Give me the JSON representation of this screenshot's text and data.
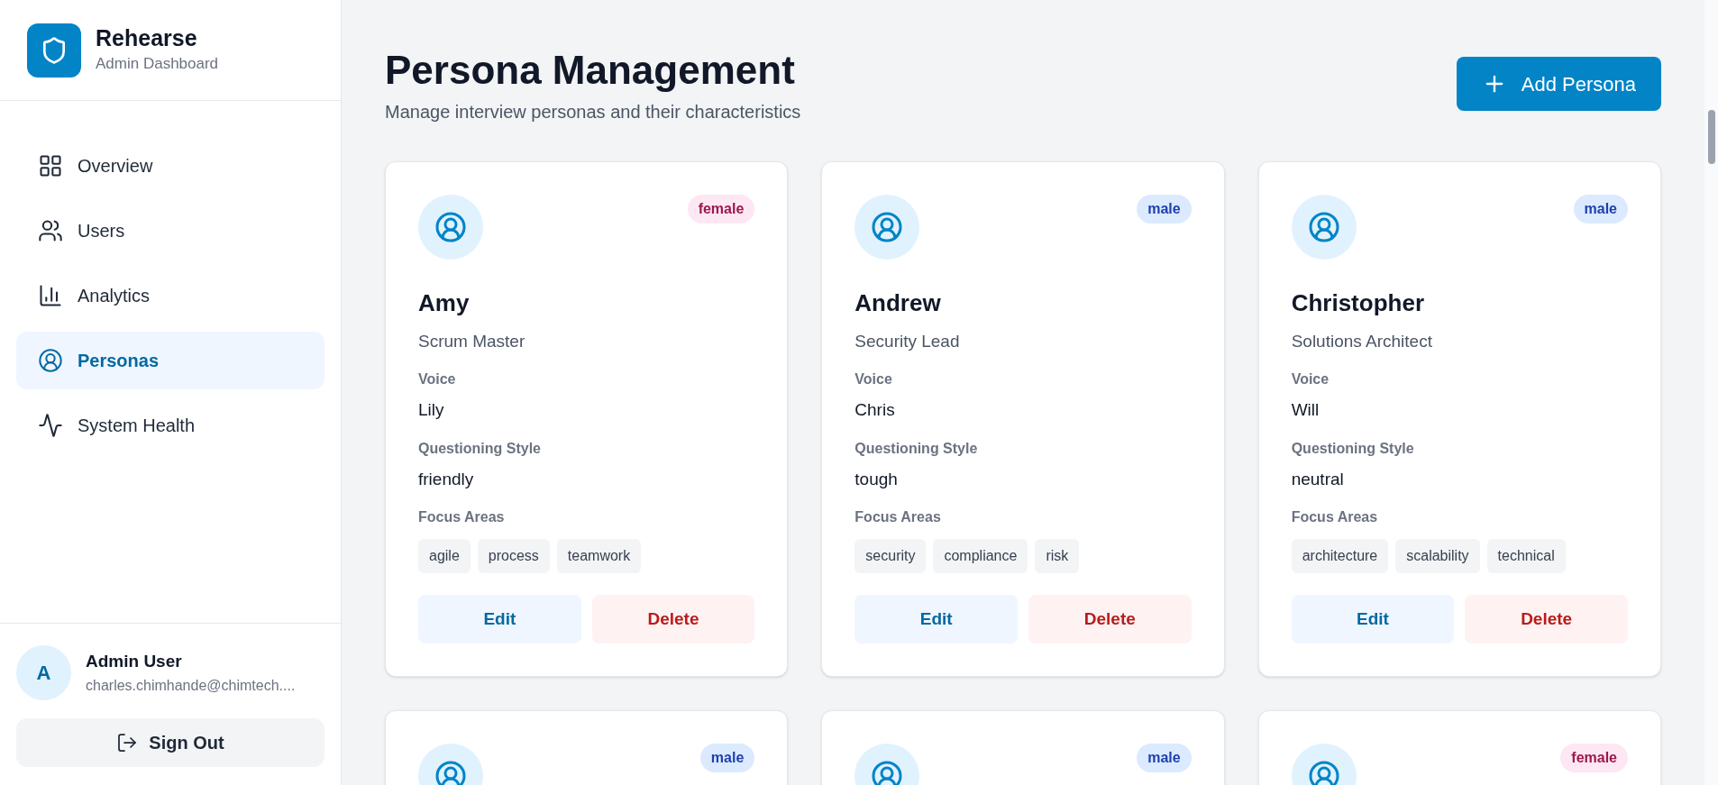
{
  "brand": {
    "title": "Rehearse",
    "subtitle": "Admin Dashboard"
  },
  "nav": [
    {
      "label": "Overview",
      "selected": false
    },
    {
      "label": "Users",
      "selected": false
    },
    {
      "label": "Analytics",
      "selected": false
    },
    {
      "label": "Personas",
      "selected": true
    },
    {
      "label": "System Health",
      "selected": false
    }
  ],
  "user": {
    "initial": "A",
    "name": "Admin User",
    "email": "charles.chimhande@chimtech...."
  },
  "sign_out": "Sign Out",
  "header": {
    "title": "Persona Management",
    "subtitle": "Manage interview personas and their characteristics",
    "add_button": "Add Persona"
  },
  "cards": [
    {
      "badge": {
        "label": "female",
        "color": "#9d174d"
      },
      "name": "Amy",
      "role": "Scrum Master",
      "fields": [
        {
          "label": "Voice",
          "value": "Lily"
        },
        {
          "label": "Questioning Style",
          "value": "friendly"
        }
      ],
      "focus_label": "Focus Areas",
      "tags": [
        "agile",
        "process",
        "teamwork"
      ],
      "actions": [
        "Edit",
        "Delete"
      ]
    },
    {
      "badge": {
        "label": "male",
        "color": "#1e40af"
      },
      "name": "Andrew",
      "role": "Security Lead",
      "fields": [
        {
          "label": "Voice",
          "value": "Chris"
        },
        {
          "label": "Questioning Style",
          "value": "tough"
        }
      ],
      "focus_label": "Focus Areas",
      "tags": [
        "security",
        "compliance",
        "risk"
      ],
      "actions": [
        "Edit",
        "Delete"
      ]
    },
    {
      "badge": {
        "label": "male",
        "color": "#1e40af"
      },
      "name": "Christopher",
      "role": "Solutions Architect",
      "fields": [
        {
          "label": "Voice",
          "value": "Will"
        },
        {
          "label": "Questioning Style",
          "value": "neutral"
        }
      ],
      "focus_label": "Focus Areas",
      "tags": [
        "architecture",
        "scalability",
        "technical"
      ],
      "actions": [
        "Edit",
        "Delete"
      ]
    },
    {
      "badge": {
        "label": "male",
        "color": "#1e40af"
      }
    },
    {
      "badge": {
        "label": "male",
        "color": "#1e40af"
      }
    },
    {
      "badge": {
        "label": "female",
        "color": "#9d174d"
      }
    }
  ]
}
